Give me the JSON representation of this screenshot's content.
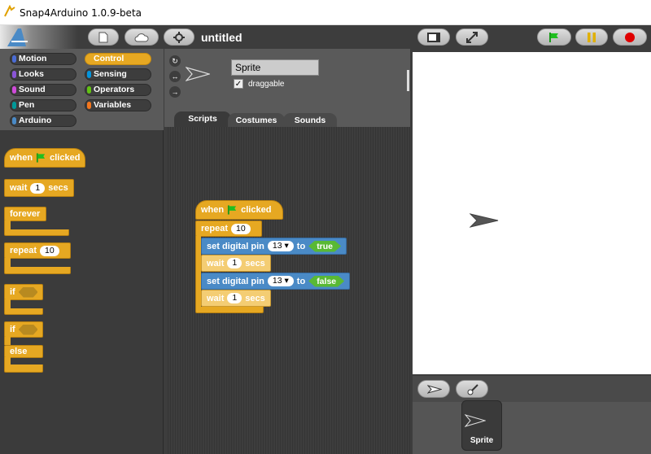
{
  "window": {
    "title": "Snap4Arduino 1.0.9-beta"
  },
  "project": {
    "title": "untitled"
  },
  "categories": [
    {
      "label": "Motion",
      "color": "#4a6cd4"
    },
    {
      "label": "Control",
      "color": "#e6a822"
    },
    {
      "label": "Looks",
      "color": "#8a55d7"
    },
    {
      "label": "Sensing",
      "color": "#0494dc"
    },
    {
      "label": "Sound",
      "color": "#cf4ad9"
    },
    {
      "label": "Operators",
      "color": "#62c213"
    },
    {
      "label": "Pen",
      "color": "#009999"
    },
    {
      "label": "Variables",
      "color": "#f3761d"
    },
    {
      "label": "Arduino",
      "color": "#4a8ac6"
    }
  ],
  "palette": {
    "when": "when",
    "clicked": "clicked",
    "wait": "wait",
    "wait_val": "1",
    "secs": "secs",
    "forever": "forever",
    "repeat": "repeat",
    "repeat_val": "10",
    "if": "if",
    "if2": "if",
    "else": "else"
  },
  "sprite": {
    "name": "Sprite",
    "draggable": "draggable"
  },
  "tabs": [
    "Scripts",
    "Costumes",
    "Sounds"
  ],
  "script": {
    "when": "when",
    "clicked": "clicked",
    "repeat": "repeat",
    "repeat_val": "10",
    "set1": "set digital pin",
    "pin1": "13",
    "to1": "to",
    "val1": "true",
    "wait1": "wait",
    "wait1_val": "1",
    "secs1": "secs",
    "set2": "set digital pin",
    "pin2": "13",
    "to2": "to",
    "val2": "false",
    "wait2": "wait",
    "wait2_val": "1",
    "secs2": "secs"
  },
  "corral": {
    "thumb_label": "Sprite"
  }
}
